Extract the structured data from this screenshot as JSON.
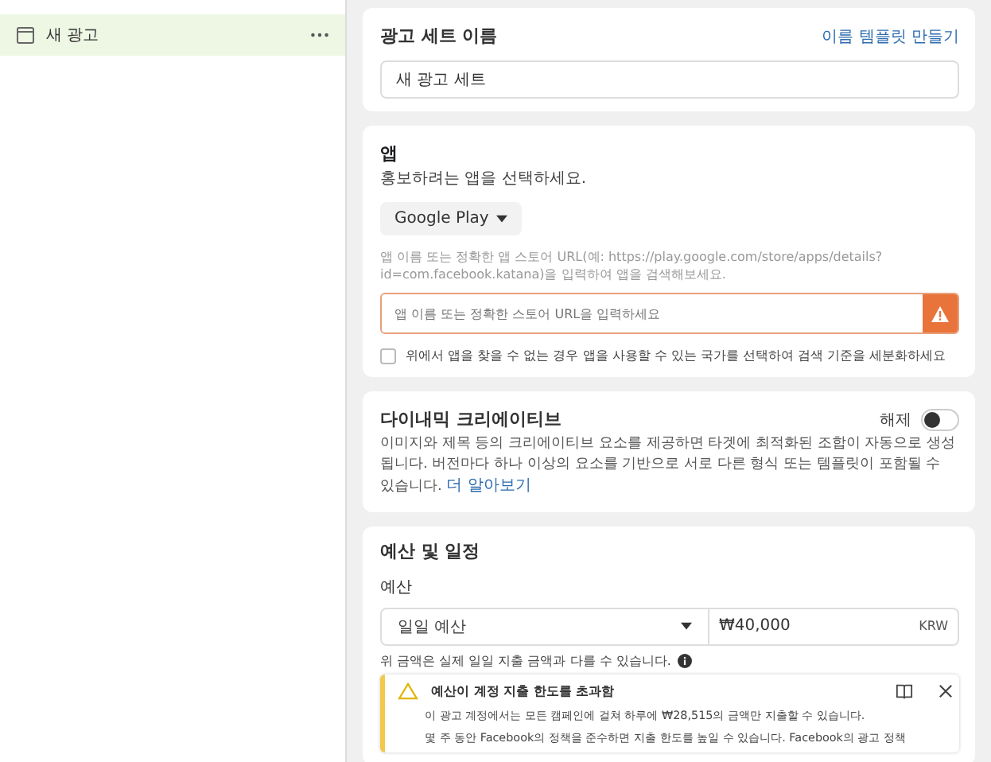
{
  "sidebar": {
    "items": [
      {
        "label": "새 광고",
        "selected": true
      }
    ]
  },
  "ad_set_name": {
    "title": "광고 세트 이름",
    "template_link": "이름 템플릿 만들기",
    "value": "새 광고 세트"
  },
  "app": {
    "title": "앱",
    "description": "홍보하려는 앱을 선택하세요.",
    "store_button": "Google Play",
    "hint": "앱 이름 또는 정확한 앱 스토어 URL(예: https://play.google.com/store/apps/details?id=com.facebook.katana)을 입력하여 앱을 검색해보세요.",
    "search": {
      "placeholder": "앱 이름 또는 정확한 스토어 URL을 입력하세요"
    },
    "country_option": {
      "label": "위에서 앱을 찾을 수 없는 경우 앱을 사용할 수 있는 국가를 선택하여 검색 기준을 세분화하세요",
      "checked": false
    }
  },
  "dynamic_creative": {
    "title": "다이내믹 크리에이티브",
    "toggle_label": "해제",
    "on": false,
    "description": "이미지와 제목 등의 크리에이티브 요소를 제공하면 타겟에 최적화된 조합이 자동으로 생성됩니다. 버전마다 하나 이상의 요소를 기반으로 서로 다른 형식 또는 템플릿이 포함될 수 있습니다.",
    "learn_more": "더 알아보기"
  },
  "budget": {
    "title": "예산 및 일정",
    "label": "예산",
    "type": "일일 예산",
    "amount": "₩40,000",
    "currency": "KRW",
    "note": "위 금액은 실제 일일 지출 금액과 다를 수 있습니다.",
    "alert": {
      "title": "예산이 계정 지출 한도를 초과함",
      "lines": [
        "이 광고 계정에서는 모든 캠페인에 걸쳐 하루에 ₩28,515의 금액만 지출할 수 있습니다.",
        "몇 주 동안 Facebook의 정책을 준수하면 지출 한도를 높일 수 있습니다. Facebook의 광고 정책"
      ]
    }
  }
}
